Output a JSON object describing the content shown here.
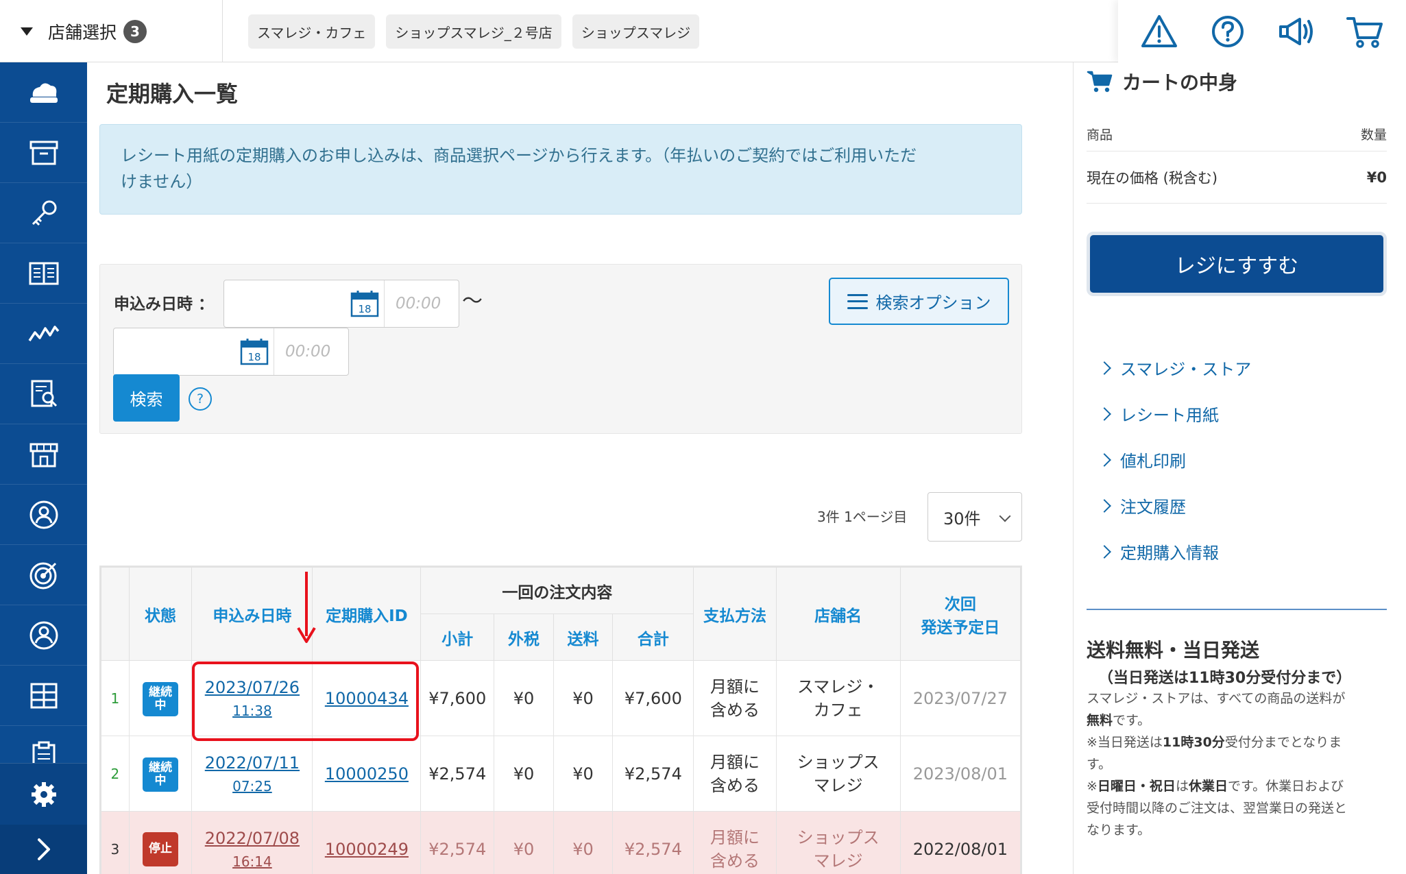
{
  "topbar": {
    "store_select_label": "店舗選択",
    "store_select_count": "3",
    "stores": [
      "スマレジ・カフェ",
      "ショップスマレジ_２号店",
      "ショップスマレジ"
    ],
    "icons": [
      "warning-icon",
      "help-icon",
      "megaphone-icon",
      "cart-icon"
    ]
  },
  "sidebar": {
    "icons": [
      "cloud-register-icon",
      "archive-icon",
      "key-icon",
      "book-icon",
      "chart-line-icon",
      "report-search-icon",
      "store-icon",
      "user-circle-icon",
      "target-icon",
      "person-icon",
      "grid-icon",
      "clipboard-icon"
    ],
    "settings_icon": "gear-icon",
    "toggle_icon": "chevron-right-icon"
  },
  "page": {
    "title": "定期購入一覧",
    "info_line1": "レシート用紙の定期購入のお申し込みは、商品選択ページから行えます。（年払いのご契約ではご利用いただ",
    "info_line2": "けません）"
  },
  "search": {
    "date_label": "申込み日時 ：",
    "from_date": "",
    "from_time_placeholder": "00:00",
    "to_date": "",
    "to_time_placeholder": "00:00",
    "calendar_day": "18",
    "tilde": "〜",
    "search_button": "検索",
    "help": "?",
    "option_button": "検索オプション"
  },
  "pager": {
    "info": "3件 1ページ目",
    "per_page": "30件"
  },
  "table": {
    "headers": {
      "status": "状態",
      "applied_at": "申込み日時",
      "sub_id": "定期購入ID",
      "order_group": "一回の注文内容",
      "subtotal": "小計",
      "tax": "外税",
      "shipping": "送料",
      "total": "合計",
      "payment": "支払方法",
      "store": "店舗名",
      "next_line1": "次回",
      "next_line2": "発送予定日"
    },
    "rows": [
      {
        "idx": "1",
        "status": "継続中",
        "status_l1": "継続",
        "status_l2": "中",
        "date": "2023/07/26",
        "time": "11:38",
        "id": "10000434",
        "subtotal": "¥7,600",
        "tax": "¥0",
        "shipping": "¥0",
        "total": "¥7,600",
        "pay_l1": "月額に",
        "pay_l2": "含める",
        "store_l1": "スマレジ・",
        "store_l2": "カフェ",
        "next": "2023/07/27"
      },
      {
        "idx": "2",
        "status": "継続中",
        "status_l1": "継続",
        "status_l2": "中",
        "date": "2022/07/11",
        "time": "07:25",
        "id": "10000250",
        "subtotal": "¥2,574",
        "tax": "¥0",
        "shipping": "¥0",
        "total": "¥2,574",
        "pay_l1": "月額に",
        "pay_l2": "含める",
        "store_l1": "ショップス",
        "store_l2": "マレジ",
        "next": "2023/08/01"
      },
      {
        "idx": "3",
        "status": "停止",
        "status_l1": "停止",
        "status_l2": "",
        "date": "2022/07/08",
        "time": "16:14",
        "id": "10000249",
        "subtotal": "¥2,574",
        "tax": "¥0",
        "shipping": "¥0",
        "total": "¥2,574",
        "pay_l1": "月額に",
        "pay_l2": "含める",
        "store_l1": "ショップス",
        "store_l2": "マレジ",
        "next": "2022/08/01"
      }
    ]
  },
  "cart": {
    "title": "カートの中身",
    "col_item": "商品",
    "col_qty": "数量",
    "price_label": "現在の価格 (税含む)",
    "price_value": "¥0",
    "checkout": "レジにすすむ",
    "links": [
      "スマレジ・ストア",
      "レシート用紙",
      "値札印刷",
      "注文履歴",
      "定期購入情報"
    ]
  },
  "shipping_info": {
    "title": "送料無料・当日発送",
    "subtitle": "（当日発送は11時30分受付分まで）",
    "p1a": "スマレジ・ストアは、すべての商品の送料が",
    "p1b": "無料",
    "p1c": "です。",
    "p2a": "※当日発送は",
    "p2b": "11時30分",
    "p2c": "受付分までとなりま",
    "p2d": "す。",
    "p3a": "※",
    "p3b": "日曜日・祝日",
    "p3c": "は",
    "p3d": "休業日",
    "p3e": "です。休業日および",
    "p3f": "受付時間以降のご注文は、翌営業日の発送と",
    "p3g": "なります。"
  },
  "colors": {
    "sidebar": "#0c4c92",
    "accent": "#1589d1",
    "highlight": "#e8111c",
    "stopped_row": "#f9e4e4"
  }
}
